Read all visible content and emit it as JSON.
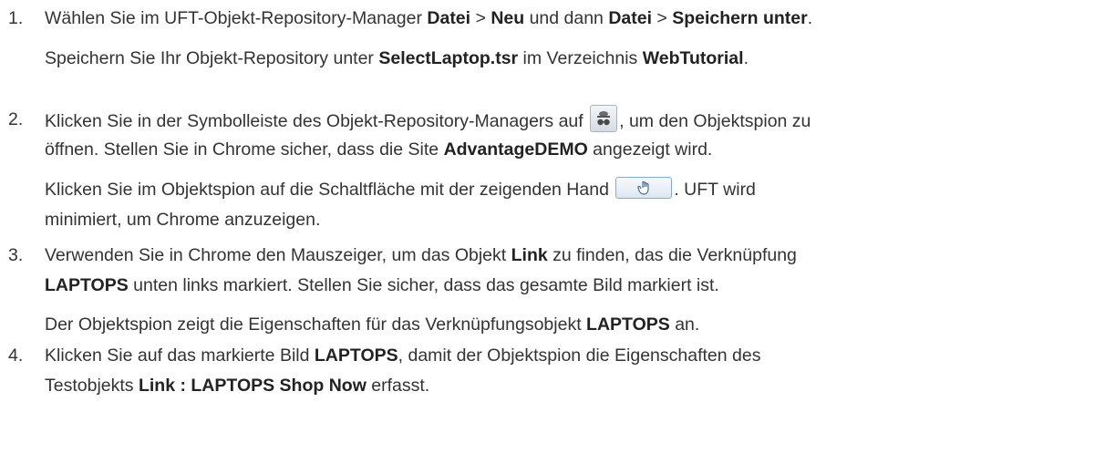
{
  "steps": [
    {
      "number": "1.",
      "line1": [
        "Wählen Sie im UFT-Objekt-Repository-Manager ",
        "Datei",
        " > ",
        "Neu",
        " und dann ",
        "Datei",
        " > ",
        "Speichern unter",
        "."
      ],
      "line2": [
        "Speichern Sie Ihr Objekt-Repository unter ",
        "SelectLaptop.tsr",
        " im Verzeichnis ",
        "WebTutorial",
        "."
      ]
    },
    {
      "number": "2.",
      "line1": [
        "Klicken Sie in der Symbolleiste des Objekt-Repository-Managers auf ",
        ", um den Objektspion zu"
      ],
      "line2": [
        "öffnen. Stellen Sie in Chrome sicher, dass die Site ",
        "AdvantageDEMO",
        " angezeigt wird."
      ],
      "line3": [
        "Klicken Sie im Objektspion auf die Schaltfläche mit der zeigenden Hand ",
        ". UFT wird"
      ],
      "line4": [
        "minimiert, um Chrome anzuzeigen."
      ],
      "icons": [
        "object-spy-icon",
        "pointing-hand-icon"
      ]
    },
    {
      "number": "3.",
      "line1": [
        "Verwenden Sie in Chrome den Mauszeiger, um das Objekt ",
        "Link",
        " zu finden, das die Verknüpfung"
      ],
      "line2": [
        "LAPTOPS",
        " unten links markiert. Stellen Sie sicher, dass das gesamte Bild markiert ist."
      ],
      "line3": [
        "Der Objektspion zeigt die Eigenschaften für das Verknüpfungsobjekt ",
        "LAPTOPS",
        " an."
      ]
    },
    {
      "number": "4.",
      "line1": [
        "Klicken Sie auf das markierte Bild ",
        "LAPTOPS",
        ", damit der Objektspion die Eigenschaften des"
      ],
      "line2": [
        "Testobjekts ",
        "Link : LAPTOPS Shop Now",
        " erfasst."
      ]
    }
  ]
}
